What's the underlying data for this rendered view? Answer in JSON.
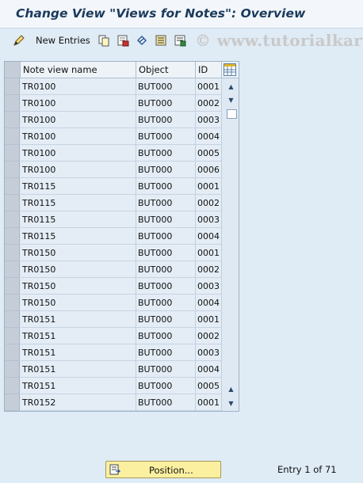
{
  "window": {
    "title": "Change View \"Views for Notes\": Overview"
  },
  "toolbar": {
    "new_entries_label": "New Entries",
    "watermark": "© www.tutorialkart",
    "icons": [
      "change-display-icon",
      "copy-icon",
      "delete-icon",
      "undo-icon",
      "select-all-icon",
      "deselect-all-icon"
    ]
  },
  "table": {
    "columns": [
      "Note view name",
      "Object",
      "ID"
    ],
    "rows": [
      [
        "TR0100",
        "BUT000",
        "0001"
      ],
      [
        "TR0100",
        "BUT000",
        "0002"
      ],
      [
        "TR0100",
        "BUT000",
        "0003"
      ],
      [
        "TR0100",
        "BUT000",
        "0004"
      ],
      [
        "TR0100",
        "BUT000",
        "0005"
      ],
      [
        "TR0100",
        "BUT000",
        "0006"
      ],
      [
        "TR0115",
        "BUT000",
        "0001"
      ],
      [
        "TR0115",
        "BUT000",
        "0002"
      ],
      [
        "TR0115",
        "BUT000",
        "0003"
      ],
      [
        "TR0115",
        "BUT000",
        "0004"
      ],
      [
        "TR0150",
        "BUT000",
        "0001"
      ],
      [
        "TR0150",
        "BUT000",
        "0002"
      ],
      [
        "TR0150",
        "BUT000",
        "0003"
      ],
      [
        "TR0150",
        "BUT000",
        "0004"
      ],
      [
        "TR0151",
        "BUT000",
        "0001"
      ],
      [
        "TR0151",
        "BUT000",
        "0002"
      ],
      [
        "TR0151",
        "BUT000",
        "0003"
      ],
      [
        "TR0151",
        "BUT000",
        "0004"
      ],
      [
        "TR0151",
        "BUT000",
        "0005"
      ],
      [
        "TR0152",
        "BUT000",
        "0001"
      ]
    ]
  },
  "footer": {
    "position_label": "Position...",
    "entry_status": "Entry 1 of 71"
  },
  "colors": {
    "background": "#dfebf5",
    "title_text": "#1b3a5c",
    "button_yellow": "#fbf0a0"
  }
}
